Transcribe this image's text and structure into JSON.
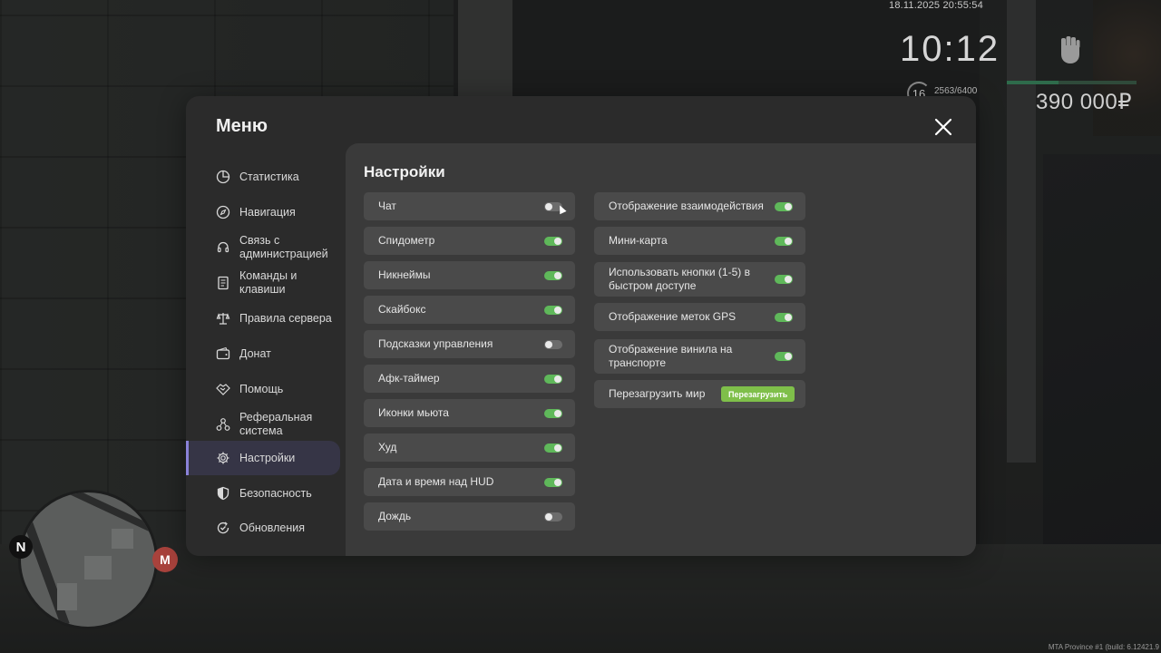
{
  "hud": {
    "datetime": "18.11.2025 20:55:54",
    "clock": "10:12",
    "level": "16",
    "xp": "2563/6400",
    "xp_progress": 0.4,
    "money": "390 000₽",
    "build": "MTA Province #1 (build: 6.12421.9"
  },
  "minimap": {
    "north": "N",
    "metro": "M"
  },
  "menu": {
    "title": "Меню",
    "nav": [
      {
        "label": "Статистика",
        "icon": "pie-chart-icon"
      },
      {
        "label": "Навигация",
        "icon": "compass-icon"
      },
      {
        "label": "Связь с администрацией",
        "icon": "headset-icon"
      },
      {
        "label": "Команды и клавиши",
        "icon": "document-icon"
      },
      {
        "label": "Правила сервера",
        "icon": "scales-icon"
      },
      {
        "label": "Донат",
        "icon": "wallet-icon"
      },
      {
        "label": "Помощь",
        "icon": "handshake-icon"
      },
      {
        "label": "Реферальная система",
        "icon": "network-icon"
      },
      {
        "label": "Настройки",
        "icon": "gear-icon",
        "active": true
      },
      {
        "label": "Безопасность",
        "icon": "shield-icon"
      },
      {
        "label": "Обновления",
        "icon": "refresh-check-icon"
      }
    ]
  },
  "settings": {
    "title": "Настройки",
    "left": [
      {
        "label": "Чат",
        "on": false
      },
      {
        "label": "Спидометр",
        "on": true
      },
      {
        "label": "Никнеймы",
        "on": true
      },
      {
        "label": "Скайбокс",
        "on": true
      },
      {
        "label": "Подсказки управления",
        "on": false
      },
      {
        "label": "Афк-таймер",
        "on": true
      },
      {
        "label": "Иконки мьюта",
        "on": true
      },
      {
        "label": "Худ",
        "on": true
      },
      {
        "label": "Дата и время над HUD",
        "on": true
      },
      {
        "label": "Дождь",
        "on": false
      }
    ],
    "right": [
      {
        "label": "Отображение взаимодействия",
        "on": true
      },
      {
        "label": "Мини-карта",
        "on": true
      },
      {
        "label": "Использовать кнопки (1-5) в быстром доступе",
        "on": true
      },
      {
        "label": "Отображение меток GPS",
        "on": true
      },
      {
        "label": "Отображение винила на транспорте",
        "on": true
      }
    ],
    "reload": {
      "label": "Перезагрузить мир",
      "button": "Перезагрузить"
    }
  },
  "colors": {
    "accent": "#8a82d8",
    "toggle_on": "#5fb85a",
    "reload_button": "#7fbf4a"
  }
}
